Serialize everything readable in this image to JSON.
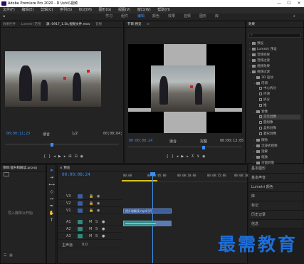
{
  "window": {
    "title": "Adobe Premiere Pro 2020 - D:\\\\shi\\\\视频",
    "min": "—",
    "max": "☐",
    "close": "✕"
  },
  "menu": [
    "文件(F)",
    "编辑(E)",
    "剪辑(C)",
    "序列(S)",
    "标记(M)",
    "图形(G)",
    "视图(V)",
    "窗口(W)",
    "帮助(H)"
  ],
  "workspaces": [
    "学习",
    "组件",
    "编辑",
    "颜色",
    "效果",
    "音频",
    "图形",
    "库"
  ],
  "source_panel": {
    "tabs": [
      "效果控件",
      "Lumetri 范围",
      "源: 0917_1.5k,视频文件.mov",
      "音频"
    ],
    "timecode_left": "00;00;11;23",
    "fit": "适合",
    "ratio": "1/2",
    "timecode_right": "00;00;04;"
  },
  "program_panel": {
    "tabs": [
      "节目:预览",
      "≡"
    ],
    "timecode_left": "00:00:08:24",
    "fit": "适合",
    "quality": "完整",
    "timecode_right": "00:00:13:05"
  },
  "project_panel": {
    "tab": "项目:提升和解读.prproj",
    "empty_hint": "导入媒体以开始"
  },
  "timeline": {
    "tab": "× 预览",
    "timecode": "00:00:08:24",
    "ruler": [
      "00:00",
      "00:00:05:00",
      "00:00:10:00",
      "00:00:15:00",
      "00:00:20:00"
    ],
    "tracks": [
      "V3",
      "V2",
      "V1",
      "A1",
      "A2",
      "A3",
      "主声道"
    ],
    "clip_v1": "提升和解读.mp4 [V]",
    "clip_a1": "",
    "master_value": "0.0"
  },
  "effects_panel": {
    "title": "效果",
    "search_placeholder": "",
    "items": [
      "预设",
      "Lumetri 预设",
      "音频效果",
      "音频过渡",
      "视频效果",
      "视频过渡",
      "3D 运动",
      "内滑",
      "划像",
      "擦除",
      "沉浸式视频",
      "溶解",
      "缩放",
      "页面剥落",
      "交叉划像",
      "圆划像",
      "盒形划像",
      "菱形划像",
      "擦除",
      "交叉溶解",
      "缩放",
      "页面剥落"
    ],
    "tree_labels": {
      "presets": "预设",
      "lumetri": "Lumetri 预设",
      "audio_fx": "音频效果",
      "audio_tr": "音频过渡",
      "video_fx": "视频效果",
      "video_tr": "视频过渡",
      "3d": "3D 运动",
      "center": "中心拆分",
      "slide": "内滑",
      "split": "拆分",
      "push": "推",
      "iris": "划像",
      "iris_cross": "交叉划像",
      "iris_round": "圆划像",
      "iris_box": "盒形划像",
      "iris_diamond": "菱形划像",
      "wipe": "擦除",
      "immersive": "沉浸式视频",
      "dissolve": "溶解",
      "zoom": "缩放",
      "page_peel": "页面剥落"
    }
  },
  "side_panels": [
    "基本图形",
    "基本声音",
    "Lumetri 颜色",
    "库",
    "标记",
    "历史记录",
    "信息"
  ],
  "watermark": "最需教育",
  "colors": {
    "accent": "#3d8ef0",
    "clip_video": "#3b5f9e",
    "clip_audio": "#3a8fa0",
    "watermark": "#1e6fd8"
  }
}
